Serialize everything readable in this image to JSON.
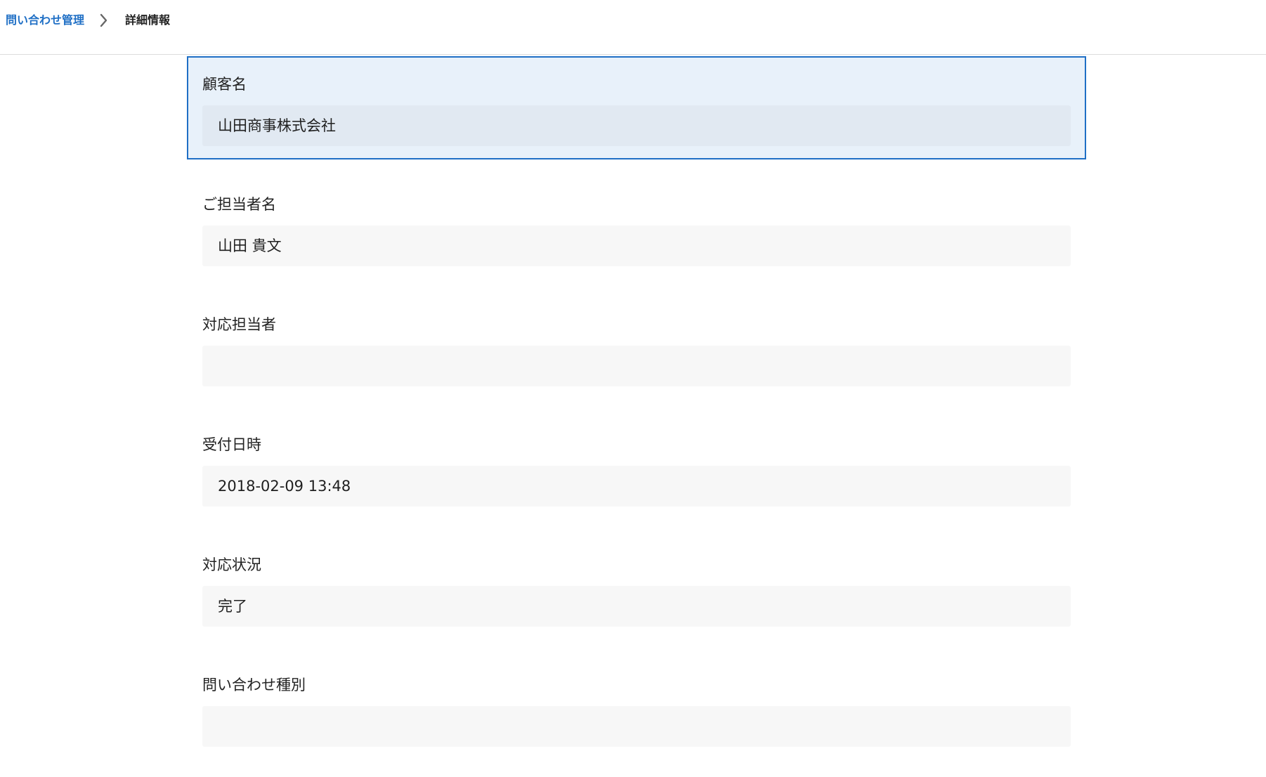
{
  "breadcrumb": {
    "parent": "問い合わせ管理",
    "current": "詳細情報"
  },
  "fields": [
    {
      "label": "顧客名",
      "value": "山田商事株式会社",
      "selected": true
    },
    {
      "label": "ご担当者名",
      "value": "山田 貴文"
    },
    {
      "label": "対応担当者",
      "value": ""
    },
    {
      "label": "受付日時",
      "value": "2018-02-09 13:48"
    },
    {
      "label": "対応状況",
      "value": "完了"
    },
    {
      "label": "問い合わせ種別",
      "value": ""
    }
  ],
  "colors": {
    "accent": "#1f6fc5",
    "selected_bg": "#e8f1fa",
    "field_bg": "#f7f7f7"
  },
  "icons": {
    "breadcrumb_separator": "chevron-right-icon"
  }
}
